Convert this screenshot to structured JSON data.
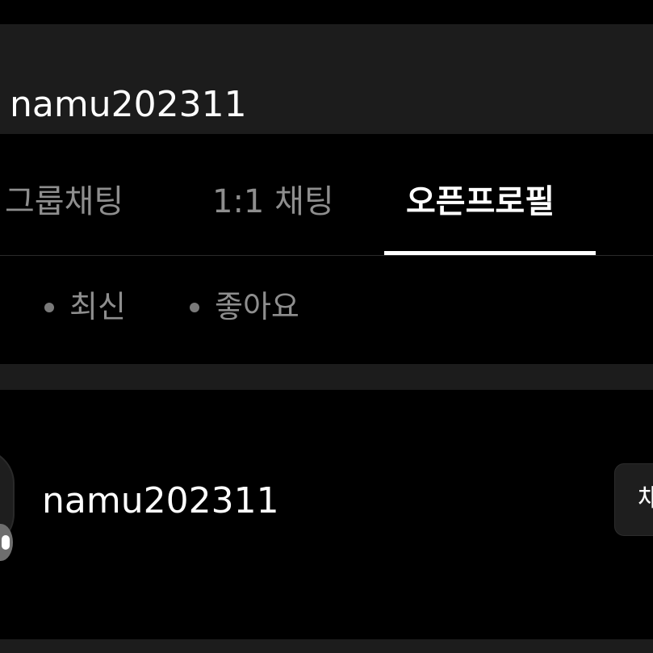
{
  "search": {
    "query": "namu202311"
  },
  "tabs": [
    {
      "label": "그룹채팅",
      "active": false
    },
    {
      "label": "1:1 채팅",
      "active": false
    },
    {
      "label": "오픈프로필",
      "active": true
    },
    {
      "label": "",
      "active": false
    }
  ],
  "sort": {
    "options": [
      "최신",
      "좋아요"
    ]
  },
  "results": [
    {
      "name": "namu202311",
      "button_label": "채"
    }
  ],
  "colors": {
    "background": "#000000",
    "panel": "#1c1c1c",
    "inactive_text": "#8e8e8e",
    "active_text": "#ffffff"
  },
  "icons": {
    "avatar_badge": "profile-badge-icon"
  }
}
